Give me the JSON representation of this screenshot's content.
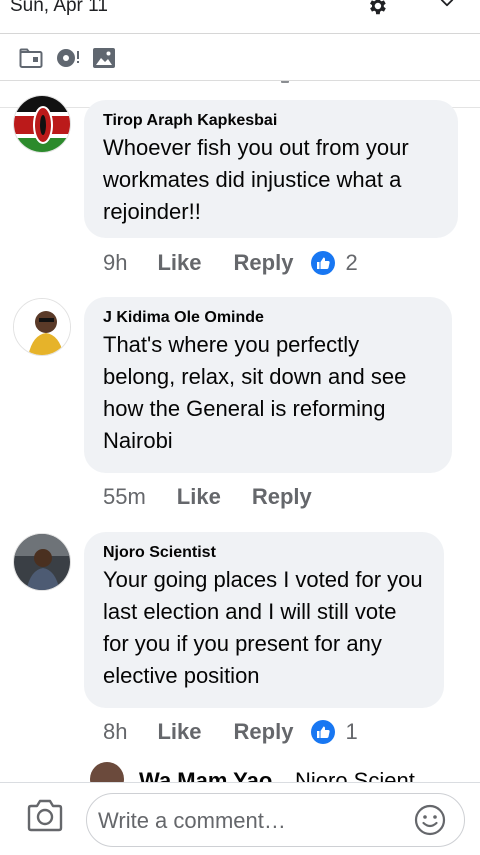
{
  "status_shade": {
    "date": "Sun, Apr 11",
    "settings_icon": "gear-icon",
    "expand_icon": "chevron-down-icon"
  },
  "toolbar": {
    "icons": [
      "file-folder-icon",
      "sticker-icon",
      "photo-icon"
    ]
  },
  "comments": [
    {
      "author": "Tirop Araph Kapkesbai",
      "text": "Whoever fish you out from your workmates did injustice what a rejoinder!!",
      "time": "9h",
      "like_label": "Like",
      "reply_label": "Reply",
      "reactions": "2"
    },
    {
      "author": "J Kidima Ole Ominde",
      "text": "That's where you perfectly belong, relax, sit down and see how the General is reforming Nairobi",
      "time": "55m",
      "like_label": "Like",
      "reply_label": "Reply"
    },
    {
      "author": "Njoro Scientist",
      "text": "Your going places I voted for you last election and I will still vote for you if you present for any elective position",
      "time": "8h",
      "like_label": "Like",
      "reply_label": "Reply",
      "reactions": "1"
    }
  ],
  "reply_preview": {
    "author": "Wa Mam Yao",
    "text": "Njoro Scient"
  },
  "composer": {
    "placeholder": "Write a comment…",
    "camera_icon": "camera-icon",
    "emoji_icon": "emoji-icon"
  },
  "colors": {
    "bubble": "#f0f2f5",
    "secondary_text": "#65676b",
    "like_blue": "#1877f2"
  }
}
